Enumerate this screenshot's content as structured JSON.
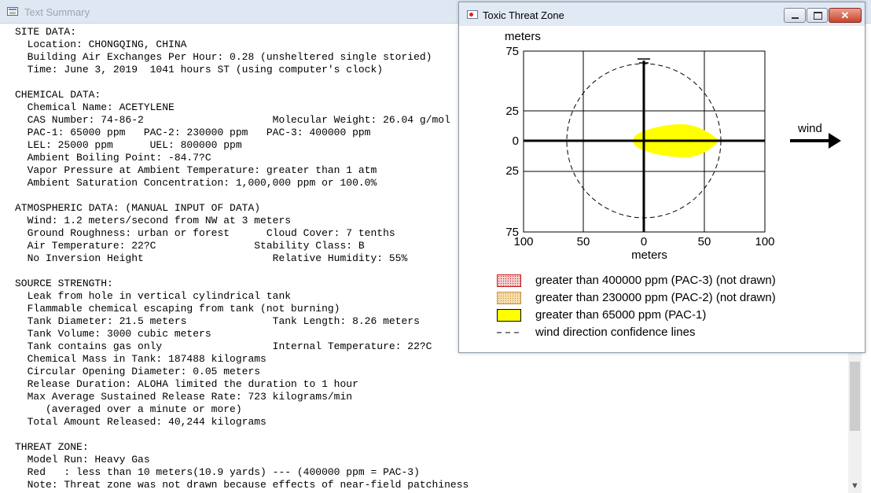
{
  "text_summary": {
    "title": "Text Summary",
    "lines": [
      "SITE DATA:",
      "  Location: CHONGQING, CHINA",
      "  Building Air Exchanges Per Hour: 0.28 (unsheltered single storied)",
      "  Time: June 3, 2019  1041 hours ST (using computer's clock)",
      "",
      "CHEMICAL DATA:",
      "  Chemical Name: ACETYLENE",
      "  CAS Number: 74-86-2                     Molecular Weight: 26.04 g/mol",
      "  PAC-1: 65000 ppm   PAC-2: 230000 ppm   PAC-3: 400000 ppm",
      "  LEL: 25000 ppm      UEL: 800000 ppm",
      "  Ambient Boiling Point: -84.7?C",
      "  Vapor Pressure at Ambient Temperature: greater than 1 atm",
      "  Ambient Saturation Concentration: 1,000,000 ppm or 100.0%",
      "",
      "ATMOSPHERIC DATA: (MANUAL INPUT OF DATA)",
      "  Wind: 1.2 meters/second from NW at 3 meters",
      "  Ground Roughness: urban or forest      Cloud Cover: 7 tenths",
      "  Air Temperature: 22?C                Stability Class: B",
      "  No Inversion Height                     Relative Humidity: 55%",
      "",
      "SOURCE STRENGTH:",
      "  Leak from hole in vertical cylindrical tank",
      "  Flammable chemical escaping from tank (not burning)",
      "  Tank Diameter: 21.5 meters              Tank Length: 8.26 meters",
      "  Tank Volume: 3000 cubic meters",
      "  Tank contains gas only                  Internal Temperature: 22?C",
      "  Chemical Mass in Tank: 187488 kilograms",
      "  Circular Opening Diameter: 0.05 meters",
      "  Release Duration: ALOHA limited the duration to 1 hour",
      "  Max Average Sustained Release Rate: 723 kilograms/min",
      "     (averaged over a minute or more)",
      "  Total Amount Released: 40,244 kilograms",
      "",
      "THREAT ZONE:",
      "  Model Run: Heavy Gas",
      "  Red   : less than 10 meters(10.9 yards) --- (400000 ppm = PAC-3)",
      "  Note: Threat zone was not drawn because effects of near-field patchiness"
    ]
  },
  "threat_zone_window": {
    "title": "Toxic Threat Zone",
    "close_symbol": "✕",
    "plot": {
      "y_unit": "meters",
      "x_unit": "meters",
      "y_tick_labels": [
        "75",
        "25",
        "0",
        "25",
        "75"
      ],
      "x_tick_labels": [
        "100",
        "50",
        "0",
        "50",
        "100"
      ],
      "wind_label": "wind"
    },
    "legend": [
      {
        "label": "greater than 400000 ppm (PAC-3) (not drawn)",
        "color": "#f0c8c8",
        "border": "#cc2020"
      },
      {
        "label": "greater than 230000 ppm (PAC-2) (not drawn)",
        "color": "#f5d9a8",
        "border": "#c8963c"
      },
      {
        "label": "greater than 65000 ppm (PAC-1)",
        "color": "#ffff00",
        "border": "#000000"
      },
      {
        "label": "wind direction confidence lines"
      }
    ]
  },
  "colors": {
    "zone_fill": "#ffff00",
    "close_button": "#c7432c"
  },
  "icons": [
    "text-summary-window-icon",
    "threat-zone-window-icon",
    "minimize-icon",
    "maximize-icon",
    "close-icon",
    "wind-arrow-icon",
    "scroll-down-arrow-icon"
  ]
}
